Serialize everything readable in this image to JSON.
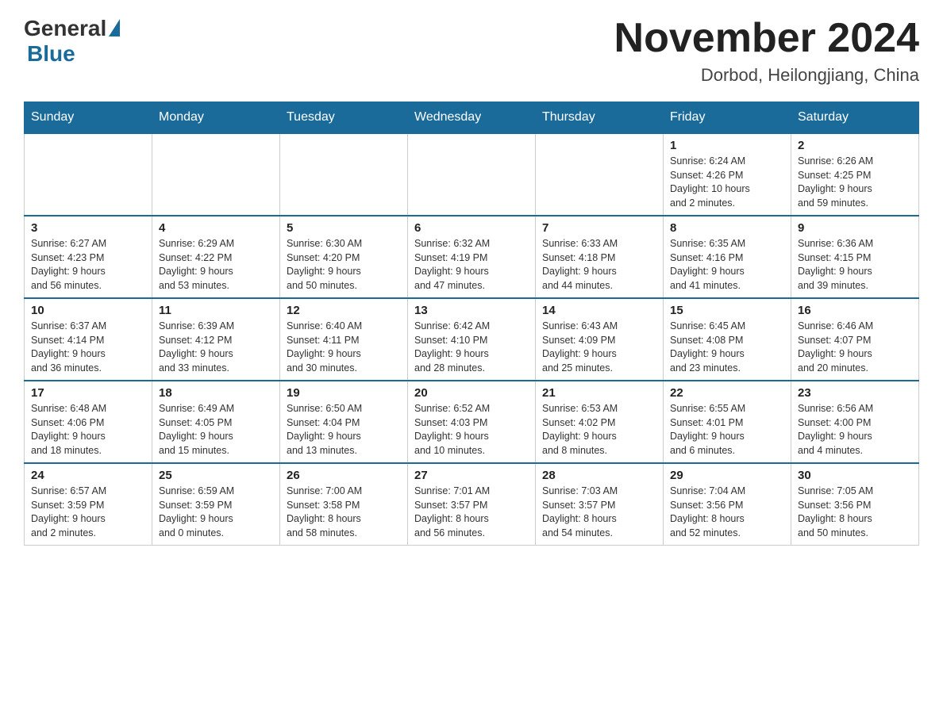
{
  "header": {
    "logo_general": "General",
    "logo_blue": "Blue",
    "month_title": "November 2024",
    "location": "Dorbod, Heilongjiang, China"
  },
  "weekdays": [
    "Sunday",
    "Monday",
    "Tuesday",
    "Wednesday",
    "Thursday",
    "Friday",
    "Saturday"
  ],
  "weeks": [
    [
      {
        "day": "",
        "info": ""
      },
      {
        "day": "",
        "info": ""
      },
      {
        "day": "",
        "info": ""
      },
      {
        "day": "",
        "info": ""
      },
      {
        "day": "",
        "info": ""
      },
      {
        "day": "1",
        "info": "Sunrise: 6:24 AM\nSunset: 4:26 PM\nDaylight: 10 hours\nand 2 minutes."
      },
      {
        "day": "2",
        "info": "Sunrise: 6:26 AM\nSunset: 4:25 PM\nDaylight: 9 hours\nand 59 minutes."
      }
    ],
    [
      {
        "day": "3",
        "info": "Sunrise: 6:27 AM\nSunset: 4:23 PM\nDaylight: 9 hours\nand 56 minutes."
      },
      {
        "day": "4",
        "info": "Sunrise: 6:29 AM\nSunset: 4:22 PM\nDaylight: 9 hours\nand 53 minutes."
      },
      {
        "day": "5",
        "info": "Sunrise: 6:30 AM\nSunset: 4:20 PM\nDaylight: 9 hours\nand 50 minutes."
      },
      {
        "day": "6",
        "info": "Sunrise: 6:32 AM\nSunset: 4:19 PM\nDaylight: 9 hours\nand 47 minutes."
      },
      {
        "day": "7",
        "info": "Sunrise: 6:33 AM\nSunset: 4:18 PM\nDaylight: 9 hours\nand 44 minutes."
      },
      {
        "day": "8",
        "info": "Sunrise: 6:35 AM\nSunset: 4:16 PM\nDaylight: 9 hours\nand 41 minutes."
      },
      {
        "day": "9",
        "info": "Sunrise: 6:36 AM\nSunset: 4:15 PM\nDaylight: 9 hours\nand 39 minutes."
      }
    ],
    [
      {
        "day": "10",
        "info": "Sunrise: 6:37 AM\nSunset: 4:14 PM\nDaylight: 9 hours\nand 36 minutes."
      },
      {
        "day": "11",
        "info": "Sunrise: 6:39 AM\nSunset: 4:12 PM\nDaylight: 9 hours\nand 33 minutes."
      },
      {
        "day": "12",
        "info": "Sunrise: 6:40 AM\nSunset: 4:11 PM\nDaylight: 9 hours\nand 30 minutes."
      },
      {
        "day": "13",
        "info": "Sunrise: 6:42 AM\nSunset: 4:10 PM\nDaylight: 9 hours\nand 28 minutes."
      },
      {
        "day": "14",
        "info": "Sunrise: 6:43 AM\nSunset: 4:09 PM\nDaylight: 9 hours\nand 25 minutes."
      },
      {
        "day": "15",
        "info": "Sunrise: 6:45 AM\nSunset: 4:08 PM\nDaylight: 9 hours\nand 23 minutes."
      },
      {
        "day": "16",
        "info": "Sunrise: 6:46 AM\nSunset: 4:07 PM\nDaylight: 9 hours\nand 20 minutes."
      }
    ],
    [
      {
        "day": "17",
        "info": "Sunrise: 6:48 AM\nSunset: 4:06 PM\nDaylight: 9 hours\nand 18 minutes."
      },
      {
        "day": "18",
        "info": "Sunrise: 6:49 AM\nSunset: 4:05 PM\nDaylight: 9 hours\nand 15 minutes."
      },
      {
        "day": "19",
        "info": "Sunrise: 6:50 AM\nSunset: 4:04 PM\nDaylight: 9 hours\nand 13 minutes."
      },
      {
        "day": "20",
        "info": "Sunrise: 6:52 AM\nSunset: 4:03 PM\nDaylight: 9 hours\nand 10 minutes."
      },
      {
        "day": "21",
        "info": "Sunrise: 6:53 AM\nSunset: 4:02 PM\nDaylight: 9 hours\nand 8 minutes."
      },
      {
        "day": "22",
        "info": "Sunrise: 6:55 AM\nSunset: 4:01 PM\nDaylight: 9 hours\nand 6 minutes."
      },
      {
        "day": "23",
        "info": "Sunrise: 6:56 AM\nSunset: 4:00 PM\nDaylight: 9 hours\nand 4 minutes."
      }
    ],
    [
      {
        "day": "24",
        "info": "Sunrise: 6:57 AM\nSunset: 3:59 PM\nDaylight: 9 hours\nand 2 minutes."
      },
      {
        "day": "25",
        "info": "Sunrise: 6:59 AM\nSunset: 3:59 PM\nDaylight: 9 hours\nand 0 minutes."
      },
      {
        "day": "26",
        "info": "Sunrise: 7:00 AM\nSunset: 3:58 PM\nDaylight: 8 hours\nand 58 minutes."
      },
      {
        "day": "27",
        "info": "Sunrise: 7:01 AM\nSunset: 3:57 PM\nDaylight: 8 hours\nand 56 minutes."
      },
      {
        "day": "28",
        "info": "Sunrise: 7:03 AM\nSunset: 3:57 PM\nDaylight: 8 hours\nand 54 minutes."
      },
      {
        "day": "29",
        "info": "Sunrise: 7:04 AM\nSunset: 3:56 PM\nDaylight: 8 hours\nand 52 minutes."
      },
      {
        "day": "30",
        "info": "Sunrise: 7:05 AM\nSunset: 3:56 PM\nDaylight: 8 hours\nand 50 minutes."
      }
    ]
  ]
}
